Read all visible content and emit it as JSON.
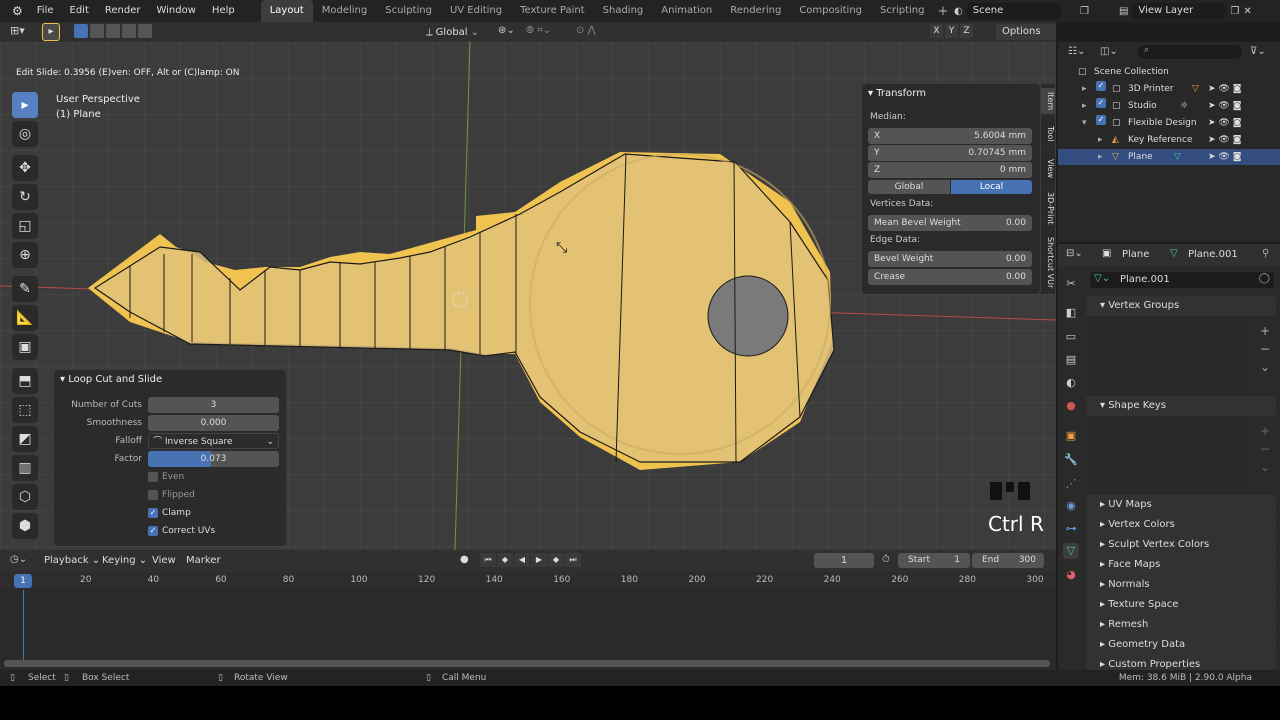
{
  "menu": {
    "file": "File",
    "edit": "Edit",
    "render": "Render",
    "window": "Window",
    "help": "Help"
  },
  "workspaces": [
    "Layout",
    "Modeling",
    "Sculpting",
    "UV Editing",
    "Texture Paint",
    "Shading",
    "Animation",
    "Rendering",
    "Compositing",
    "Scripting"
  ],
  "scene": {
    "label": "Scene",
    "view_layer": "View Layer"
  },
  "viewport_header": {
    "orientation": "Global",
    "options": "Options",
    "axes": [
      "X",
      "Y",
      "Z"
    ]
  },
  "status_msg": "Edit Slide: 0.3956 (E)ven: OFF, Alt or (C)lamp: ON",
  "view_info": {
    "line1": "User Perspective",
    "line2": "(1) Plane"
  },
  "npanel": {
    "title": "Transform",
    "median": "Median:",
    "x_label": "X",
    "x": "5.6004 mm",
    "y_label": "Y",
    "y": "0.70745 mm",
    "z_label": "Z",
    "z": "0 mm",
    "global": "Global",
    "local": "Local",
    "vertices_data": "Vertices Data:",
    "mean_bevel": "Mean Bevel Weight",
    "mean_bevel_val": "0.00",
    "edge_data": "Edge Data:",
    "bevel_weight": "Bevel Weight",
    "bevel_weight_val": "0.00",
    "crease": "Crease",
    "crease_val": "0.00"
  },
  "side_tabs": [
    "Item",
    "Tool",
    "View",
    "3D-Print",
    "Shortcut VUr"
  ],
  "operator": {
    "title": "Loop Cut and Slide",
    "cuts_label": "Number of Cuts",
    "cuts": "3",
    "smooth_label": "Smoothness",
    "smooth": "0.000",
    "falloff_label": "Falloff",
    "falloff": "Inverse Square",
    "factor_label": "Factor",
    "factor": "0.073",
    "factor_fraction": 0.48,
    "even": "Even",
    "flipped": "Flipped",
    "clamp": "Clamp",
    "correct_uvs": "Correct UVs"
  },
  "key_overlay": "Ctrl R",
  "timeline": {
    "playback": "Playback",
    "keying": "Keying",
    "view": "View",
    "marker": "Marker",
    "current": "1",
    "start_label": "Start",
    "start": "1",
    "end_label": "End",
    "end": "300",
    "ticks": [
      "20",
      "40",
      "60",
      "80",
      "100",
      "120",
      "140",
      "160",
      "180",
      "200",
      "220",
      "240",
      "260",
      "280",
      "300"
    ],
    "frame_indicator": "1"
  },
  "outliner": {
    "root": "Scene Collection",
    "items": [
      {
        "name": "3D Printer"
      },
      {
        "name": "Studio"
      },
      {
        "name": "Flexible Design"
      },
      {
        "name": "Key Reference"
      },
      {
        "name": "Plane"
      }
    ]
  },
  "props": {
    "object": "Plane",
    "mesh": "Plane.001",
    "mesh_field": "Plane.001",
    "sections": [
      "Vertex Groups",
      "Shape Keys",
      "UV Maps",
      "Vertex Colors",
      "Sculpt Vertex Colors",
      "Face Maps",
      "Normals",
      "Texture Space",
      "Remesh",
      "Geometry Data",
      "Custom Properties"
    ]
  },
  "statusbar": {
    "select": "Select",
    "box_select": "Box Select",
    "rotate": "Rotate View",
    "call_menu": "Call Menu",
    "mem": "Mem: 38.6 MiB | 2.90.0 Alpha"
  },
  "colors": {
    "accent": "#4772b3",
    "key": "#f0c24f",
    "grid_red": "#b84a4a",
    "grid_green": "#6a9b3a",
    "selected": "#334d80"
  }
}
